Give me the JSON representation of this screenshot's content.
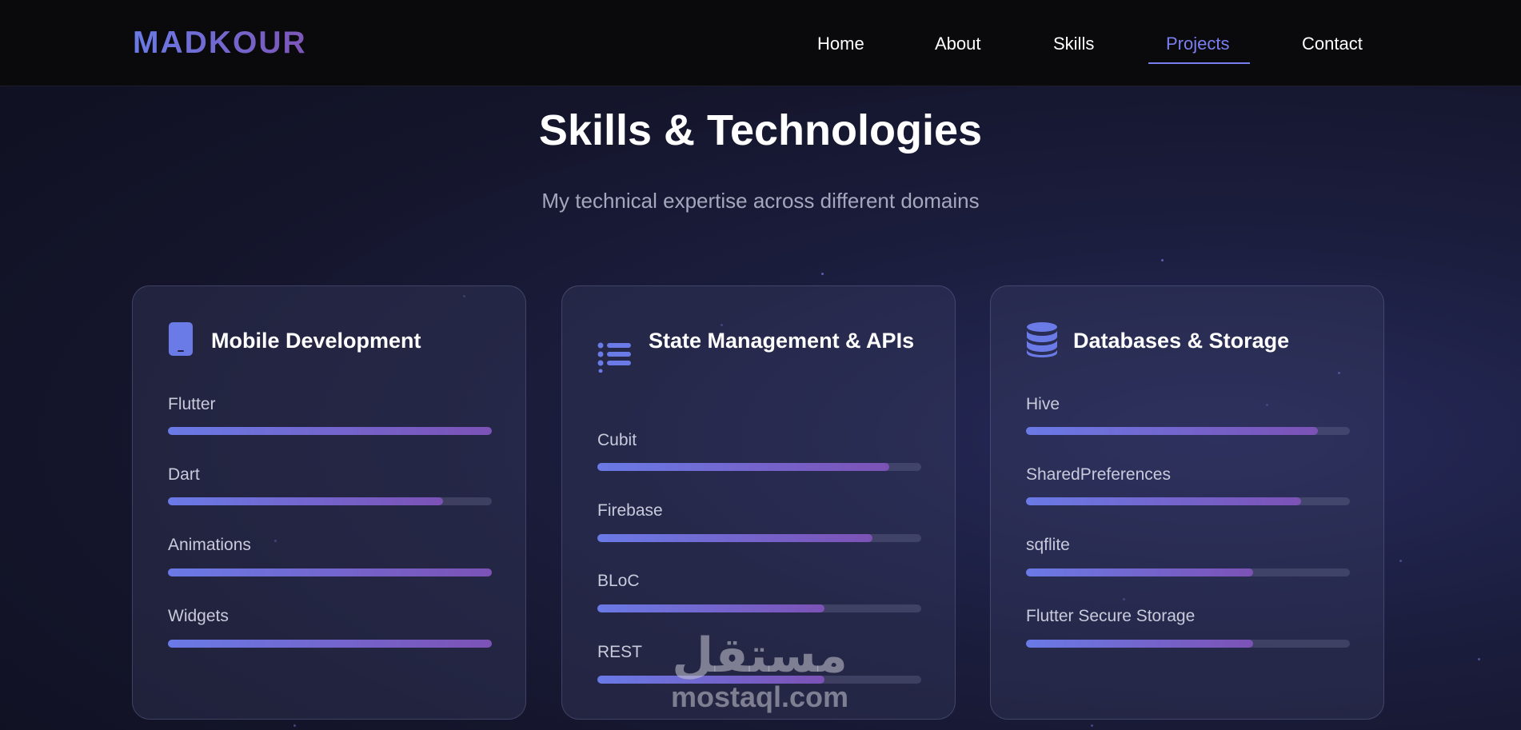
{
  "header": {
    "logo": "MADKOUR",
    "nav": [
      "Home",
      "About",
      "Skills",
      "Projects",
      "Contact"
    ],
    "active_nav": "Projects"
  },
  "section": {
    "title": "Skills & Technologies",
    "subtitle": "My technical expertise across different domains"
  },
  "cards": [
    {
      "title": "Mobile Development",
      "icon": "mobile-phone-icon",
      "skills": [
        {
          "name": "Flutter",
          "level": 1.0
        },
        {
          "name": "Dart",
          "level": 0.85
        },
        {
          "name": "Animations",
          "level": 1.0
        },
        {
          "name": "Widgets",
          "level": 1.0
        }
      ]
    },
    {
      "title": "State Management & APIs",
      "icon": "list-icon",
      "skills": [
        {
          "name": "Cubit",
          "level": 0.9
        },
        {
          "name": "Firebase",
          "level": 0.85
        },
        {
          "name": "BLoC",
          "level": 0.7
        },
        {
          "name": "REST",
          "level": 0.7
        }
      ]
    },
    {
      "title": "Databases & Storage",
      "icon": "database-icon",
      "skills": [
        {
          "name": "Hive",
          "level": 0.9
        },
        {
          "name": "SharedPreferences",
          "level": 0.85
        },
        {
          "name": "sqflite",
          "level": 0.7
        },
        {
          "name": "Flutter Secure Storage",
          "level": 0.7
        }
      ]
    }
  ],
  "watermark": {
    "arabic": "مستقل",
    "latin": "mostaql.com"
  },
  "colors": {
    "accent": "#7a7ff0",
    "gradient_start": "#6a7ae6",
    "gradient_end": "#7c52b6"
  }
}
